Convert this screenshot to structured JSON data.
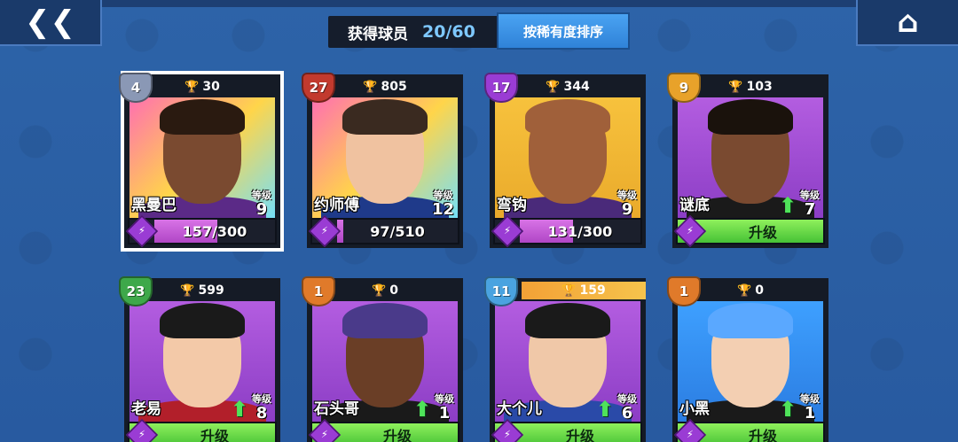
{
  "header": {
    "obtained_label": "获得球员",
    "obtained_count": "20/60",
    "sort_label": "按稀有度排序"
  },
  "nav": {
    "back_glyph": "❮❮",
    "home_glyph": "⌂"
  },
  "cards": [
    {
      "rank": "4",
      "rank_color": "#8a98b5",
      "trophies": "30",
      "name": "黑曼巴",
      "level_label": "等级",
      "level": "9",
      "progress_text": "157/300",
      "progress_fraction": 0.52,
      "can_upgrade": false,
      "selected": true,
      "bg": "linear-gradient(135deg,#ff6fb1 0%,#ffd54a 50%,#6fe0ff 100%)",
      "skin": "#7a4a30",
      "hair": "#2a1a10",
      "jersey": "#5b2a87"
    },
    {
      "rank": "27",
      "rank_color": "#c23a2e",
      "trophies": "805",
      "name": "约师傅",
      "level_label": "等级",
      "level": "12",
      "progress_text": "97/510",
      "progress_fraction": 0.05,
      "can_upgrade": false,
      "selected": false,
      "bg": "linear-gradient(135deg,#ff6fb1 0%,#ffd54a 50%,#6fe0ff 100%)",
      "skin": "#f0c2a0",
      "hair": "#3a2a20",
      "jersey": "#1f3a8a"
    },
    {
      "rank": "17",
      "rank_color": "#9a3cd4",
      "trophies": "344",
      "name": "弯钩",
      "level_label": "等级",
      "level": "9",
      "progress_text": "131/300",
      "progress_fraction": 0.44,
      "can_upgrade": false,
      "selected": false,
      "bg": "linear-gradient(180deg,#f7c23d 0%,#e9a92a 100%)",
      "skin": "#a0603a",
      "hair": "#a0603a",
      "jersey": "#4a2a7a"
    },
    {
      "rank": "9",
      "rank_color": "#e8a22a",
      "trophies": "103",
      "name": "谜底",
      "level_label": "等级",
      "level": "7",
      "upgrade_text": "升级",
      "can_upgrade": true,
      "selected": false,
      "bg": "linear-gradient(180deg,#b35de0 0%,#8a3cc4 100%)",
      "skin": "#7a4a30",
      "hair": "#1a120c",
      "jersey": "#1a1a1a"
    },
    {
      "rank": "23",
      "rank_color": "#3ea84a",
      "trophies": "599",
      "name": "老易",
      "level_label": "等级",
      "level": "8",
      "upgrade_text": "升级",
      "can_upgrade": true,
      "selected": false,
      "bg": "linear-gradient(180deg,#b35de0 0%,#8a3cc4 100%)",
      "skin": "#f3c9a8",
      "hair": "#1a1a1a",
      "jersey": "#b21f2a"
    },
    {
      "rank": "1",
      "rank_color": "#e07a2a",
      "trophies": "0",
      "name": "石头哥",
      "level_label": "等级",
      "level": "1",
      "upgrade_text": "升级",
      "can_upgrade": true,
      "selected": false,
      "bg": "linear-gradient(180deg,#b35de0 0%,#8a3cc4 100%)",
      "skin": "#6a3e26",
      "hair": "#4a3a8a",
      "jersey": "#1a1a1a"
    },
    {
      "rank": "11",
      "rank_color": "#4aa3e0",
      "trophies": "159",
      "trophy_highlight": true,
      "name": "大个儿",
      "level_label": "等级",
      "level": "6",
      "upgrade_text": "升级",
      "can_upgrade": true,
      "selected": false,
      "bg": "linear-gradient(180deg,#b35de0 0%,#8a3cc4 100%)",
      "skin": "#f0c8a8",
      "hair": "#1a1a1a",
      "jersey": "#2a4aa8"
    },
    {
      "rank": "1",
      "rank_color": "#e07a2a",
      "trophies": "0",
      "name": "小黑",
      "level_label": "等级",
      "level": "1",
      "upgrade_text": "升级",
      "can_upgrade": true,
      "selected": false,
      "bg": "linear-gradient(180deg,#3ea0ff 0%,#2a7be0 100%)",
      "skin": "#f3cfb2",
      "hair": "#5aa8ff",
      "jersey": "#1a1a1a"
    }
  ]
}
